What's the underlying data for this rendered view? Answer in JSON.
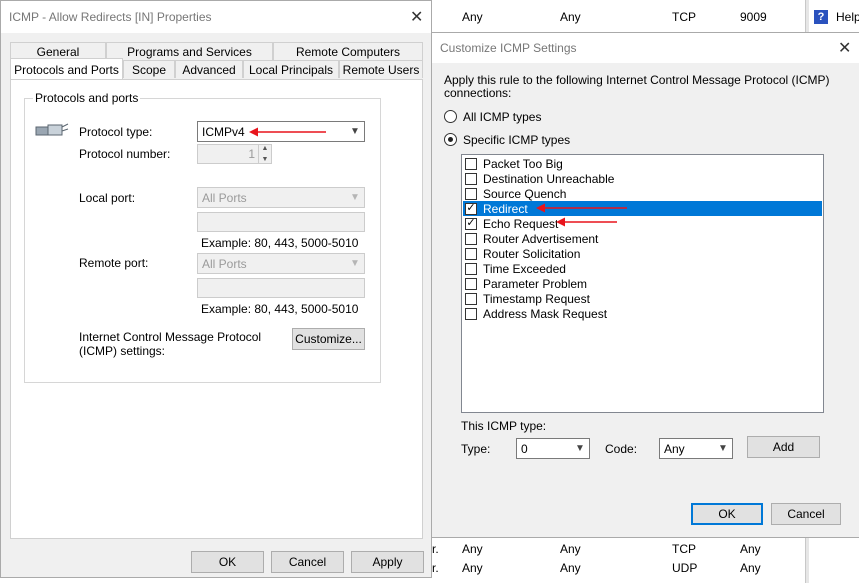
{
  "background": {
    "rows": [
      {
        "c1": "Any",
        "c2": "Any",
        "c3": "TCP",
        "c4": "9009",
        "prefix": ""
      },
      {
        "c1": "Any",
        "c2": "Any",
        "c3": "TCP",
        "c4": "Any",
        "prefix": "r."
      },
      {
        "c1": "Any",
        "c2": "Any",
        "c3": "UDP",
        "c4": "Any",
        "prefix": "r."
      }
    ],
    "help_label": "Help"
  },
  "properties": {
    "title": "ICMP - Allow Redirects [IN] Properties",
    "tabs_top": [
      "General",
      "Programs and Services",
      "Remote Computers"
    ],
    "tabs_bottom": [
      "Protocols and Ports",
      "Scope",
      "Advanced",
      "Local Principals",
      "Remote Users"
    ],
    "group_title": "Protocols and ports",
    "protocol_type_label": "Protocol type:",
    "protocol_type_value": "ICMPv4",
    "protocol_number_label": "Protocol number:",
    "protocol_number_value": "1",
    "local_port_label": "Local port:",
    "local_port_value": "All Ports",
    "local_example": "Example: 80, 443, 5000-5010",
    "remote_port_label": "Remote port:",
    "remote_port_value": "All Ports",
    "remote_example": "Example: 80, 443, 5000-5010",
    "icmp_settings_label_1": "Internet Control Message Protocol",
    "icmp_settings_label_2": "(ICMP) settings:",
    "customize_button": "Customize...",
    "ok_button": "OK",
    "cancel_button": "Cancel",
    "apply_button": "Apply"
  },
  "icmp_dialog": {
    "title": "Customize ICMP Settings",
    "intro_1": "Apply this rule to the following Internet Control Message Protocol (ICMP)",
    "intro_2": "connections:",
    "all_types_label": "All ICMP types",
    "specific_types_label": "Specific ICMP types",
    "types": [
      {
        "label": "Packet Too Big",
        "checked": false,
        "selected": false
      },
      {
        "label": "Destination Unreachable",
        "checked": false,
        "selected": false
      },
      {
        "label": "Source Quench",
        "checked": false,
        "selected": false
      },
      {
        "label": "Redirect",
        "checked": true,
        "selected": true
      },
      {
        "label": "Echo Request",
        "checked": true,
        "selected": false
      },
      {
        "label": "Router Advertisement",
        "checked": false,
        "selected": false
      },
      {
        "label": "Router Solicitation",
        "checked": false,
        "selected": false
      },
      {
        "label": "Time Exceeded",
        "checked": false,
        "selected": false
      },
      {
        "label": "Parameter Problem",
        "checked": false,
        "selected": false
      },
      {
        "label": "Timestamp Request",
        "checked": false,
        "selected": false
      },
      {
        "label": "Address Mask Request",
        "checked": false,
        "selected": false
      }
    ],
    "this_type_label": "This ICMP type:",
    "type_label": "Type:",
    "type_value": "0",
    "code_label": "Code:",
    "code_value": "Any",
    "add_button": "Add",
    "ok_button": "OK",
    "cancel_button": "Cancel"
  },
  "colors": {
    "selection": "#0078d7",
    "annotation_arrow": "#e8141c",
    "dialog_bg": "#f0f0f0"
  }
}
